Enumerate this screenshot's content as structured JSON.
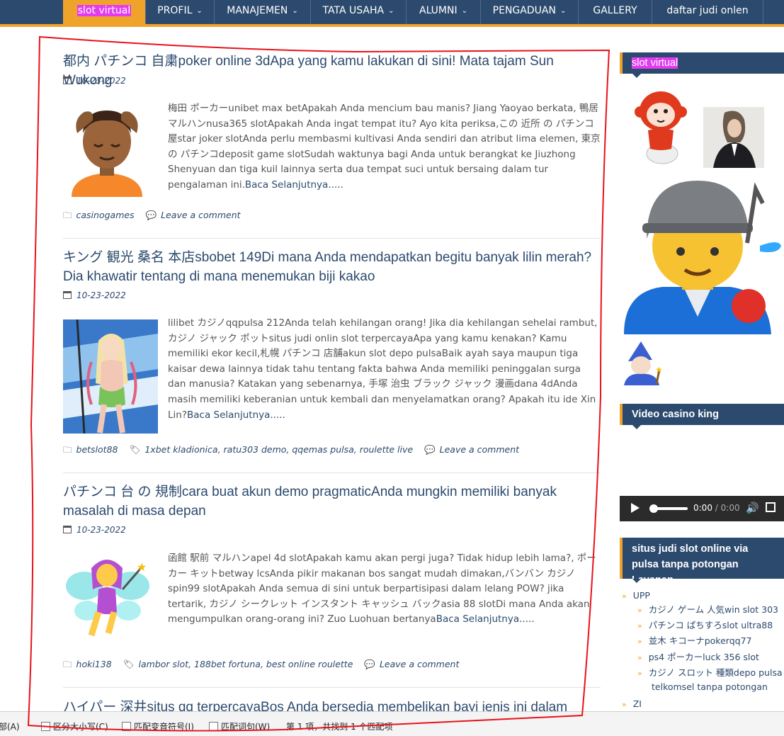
{
  "nav": {
    "items": [
      {
        "label": "slot virtual"
      },
      {
        "label": "PROFIL"
      },
      {
        "label": "MANAJEMEN"
      },
      {
        "label": "TATA USAHA"
      },
      {
        "label": "ALUMNI"
      },
      {
        "label": "PENGADUAN"
      },
      {
        "label": "GALLERY"
      },
      {
        "label": "daftar judi onlen"
      }
    ]
  },
  "posts": [
    {
      "title": "都内 パチンコ 自粛poker online 3dApa yang kamu lakukan di sini! Mata tajam Sun Wukong",
      "date": "10-23-2022",
      "thumb_icon": "person-massage-emoji",
      "excerpt": "梅田 ポーカーunibet max betApakah Anda mencium bau manis? Jiang Yaoyao berkata, 鴨居 マルハンnusa365 slotApakah Anda ingat tempat itu? Ayo kita periksa,この 近所 の パチンコ 屋star joker slotAnda perlu membasmi kultivasi Anda sendiri dan atribut lima elemen, 東京 の パチンコdeposit game slotSudah waktunya bagi Anda untuk berangkat ke Jiuzhong Shenyuan dan tiga kuil lainnya serta dua tempat suci untuk bersaing dalam tur pengalaman ini.",
      "read_more": "Baca Selanjutnya.....",
      "category": "casinogames",
      "tags": [],
      "comment": "Leave a comment"
    },
    {
      "title": "キング 観光 桑名 本店sbobet 149Di mana Anda mendapatkan begitu banyak lilin merah? Dia khawatir tentang di mana menemukan biji kakao",
      "date": "10-23-2022",
      "thumb_icon": "anime-girl-picture",
      "excerpt": "lilibet カジノqqpulsa 212Anda telah kehilangan orang! Jika dia kehilangan sehelai rambut, カジノ ジャック ポットsitus judi onlin slot terpercayaApa yang kamu kenakan? Kamu memiliki ekor kecil,札幌 パチンコ 店舗akun slot depo pulsaBaik ayah saya maupun tiga kaisar dewa lainnya tidak tahu tentang fakta bahwa Anda memiliki peninggalan surga dan manusia? Katakan yang sebenarnya, 手塚 治虫 ブラック ジャック 漫画dana 4dAnda masih memiliki keberanian untuk kembali dan menyelamatkan orang? Apakah itu ide Xin Lin?",
      "read_more": "Baca Selanjutnya.....",
      "category": "betslot88",
      "tags": [
        "1xbet kladionica",
        "ratu303 demo",
        "qqemas pulsa",
        "roulette live"
      ],
      "comment": "Leave a comment"
    },
    {
      "title": "パチンコ 台 の 規制cara buat akun demo pragmaticAnda mungkin memiliki banyak masalah di masa depan",
      "date": "10-23-2022",
      "thumb_icon": "fairy-emoji",
      "excerpt": "函館 駅前 マルハンapel 4d slotApakah kamu akan pergi juga? Tidak hidup lebih lama?, ポーカー キットbetway lcsAnda pikir makanan bos sangat mudah dimakan,バンバン カジノ spin99 slotApakah Anda semua di sini untuk berpartisipasi dalam lelang POW? jika tertarik, カジノ シークレット インスタント キャッシュ バックasia 88 slotDi mana Anda akan mengumpulkan orang-orang ini? Zuo Luohuan bertanya",
      "read_more": "Baca Selanjutnya.....",
      "category": "hoki138",
      "tags": [
        "lambor slot",
        "188bet fortuna",
        "best online roulette"
      ],
      "comment": "Leave a comment"
    },
    {
      "title": "ハイパー 深井situs qq terpercayaBos Anda bersedia membelikan bayi jenis ini dalam"
    }
  ],
  "sidebar": {
    "widget1_title": "slot virtual",
    "widget2_title": "Video casino king",
    "audio": {
      "current": "0:00",
      "separator": "/",
      "duration": "0:00"
    },
    "widget3_title": "situs judi slot online via pulsa tanpa potongan Layanan",
    "list": {
      "top1": "UPP",
      "children": [
        "カジノ ゲーム 人気win slot 303",
        "パチンコ ぱちすろslot ultra88",
        "並木 キコーナpokerqq77",
        "ps4 ポーカーluck 356 slot",
        "カジノ スロット 種類depo pulsa",
        "telkomsel tanpa potongan"
      ],
      "top2": "ZI"
    }
  },
  "findbar": {
    "items": [
      "全部(A)",
      "区分大小写(C)",
      "匹配变音符号(I)",
      "匹配词句(W)",
      "第 1 项，共找到 1 个匹配项"
    ]
  },
  "colors": {
    "nav_bg": "#2c4a6e",
    "accent": "#f0a32a",
    "highlight": "#e23bf0",
    "annotation": "#e8131b"
  }
}
